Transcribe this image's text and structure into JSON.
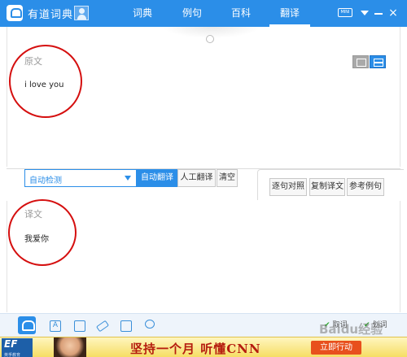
{
  "app": {
    "title": "有道词典",
    "icons": {
      "logo": "youdao-logo-icon",
      "user": "user-avatar-icon"
    }
  },
  "nav": {
    "tabs": [
      {
        "label": "词典",
        "active": false
      },
      {
        "label": "例句",
        "active": false
      },
      {
        "label": "百科",
        "active": false
      },
      {
        "label": "翻译",
        "active": true
      }
    ]
  },
  "window_controls": {
    "mini_label": "MINI",
    "close_label": "×"
  },
  "source": {
    "label": "原文",
    "text": "i love you"
  },
  "toolbar": {
    "language_select": "自动检测",
    "auto_translate": "自动翻译",
    "human_translate": "人工翻译",
    "clear": "清空",
    "sentence_compare": "逐句对照",
    "copy_translation": "复制译文",
    "reference_examples": "参考例句"
  },
  "result": {
    "label": "译文",
    "text": "我爱你"
  },
  "bottom_bar": {
    "checks": [
      {
        "label": "取词",
        "checked": true
      },
      {
        "label": "划词",
        "checked": true
      }
    ]
  },
  "ad": {
    "logo": "EF",
    "logo_sub": "英孚教育",
    "headline": "坚持一个月 听懂CNN",
    "cta": "立即行动"
  },
  "watermark": "Baidu经验",
  "colors": {
    "accent": "#2b8ee8",
    "annotation": "#d50f0f",
    "ad_text": "#b51c0f"
  }
}
